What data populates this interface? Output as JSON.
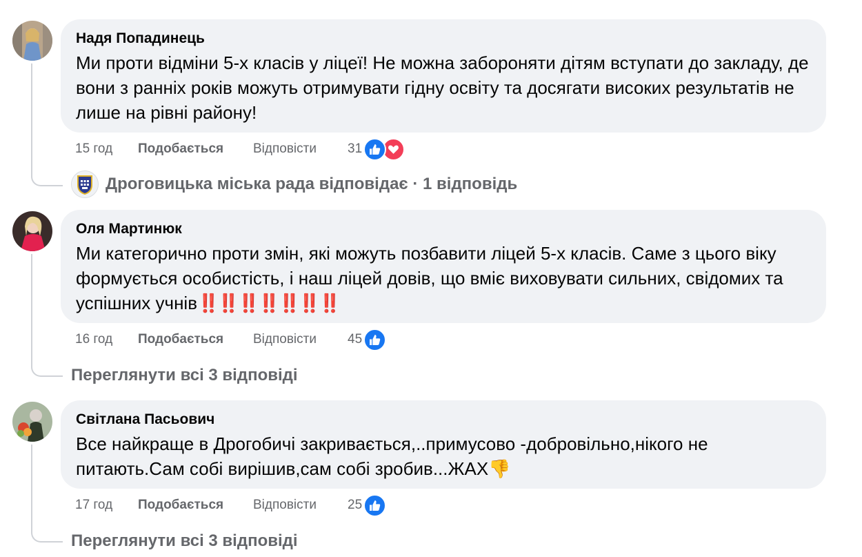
{
  "comments": [
    {
      "author": "Надя Попадинець",
      "text": "Ми проти відміни 5-х класів у ліцеї! Не можна забороняти дітям вступати до закладу, де вони з ранніх років можуть отримувати гідну освіту та досягати високих результатів не лише на рівні району!",
      "time": "15 год",
      "like_label": "Подобається",
      "reply_label": "Відповісти",
      "reaction_count": "31",
      "reactions": [
        "like-icon",
        "love-icon"
      ],
      "footer": {
        "type": "page-reply",
        "label": "Дроговицька міська рада відповідає · 1 відповідь"
      }
    },
    {
      "author": "Оля Мартинюк",
      "text": "Ми категорично проти змін, які можуть позбавити ліцей 5-х класів. Саме з цього віку формується особистість, і наш ліцей довів, що вміє виховувати сильних, свідомих та успішних учнів",
      "text_emoji": "‼️‼️‼️‼️‼️‼️‼️",
      "time": "16 год",
      "like_label": "Подобається",
      "reply_label": "Відповісти",
      "reaction_count": "45",
      "reactions": [
        "like-icon"
      ],
      "footer": {
        "type": "more",
        "label": "Переглянути всі 3 відповіді"
      }
    },
    {
      "author": "Світлана Пасьович",
      "text": "Все найкраще в Дрогобичі закривається,..примусово -добровільно,нікого не питають.Сам собі вирішив,сам собі зробив...ЖАХ",
      "text_emoji": "👎",
      "time": "17 год",
      "like_label": "Подобається",
      "reply_label": "Відповісти",
      "reaction_count": "25",
      "reactions": [
        "like-icon"
      ],
      "footer": {
        "type": "more",
        "label": "Переглянути всі 3 відповіді"
      }
    }
  ],
  "colors": {
    "like": "#1877f2",
    "love": "#f33e58",
    "bubble": "#f0f2f5",
    "secondary_text": "#65676b"
  }
}
